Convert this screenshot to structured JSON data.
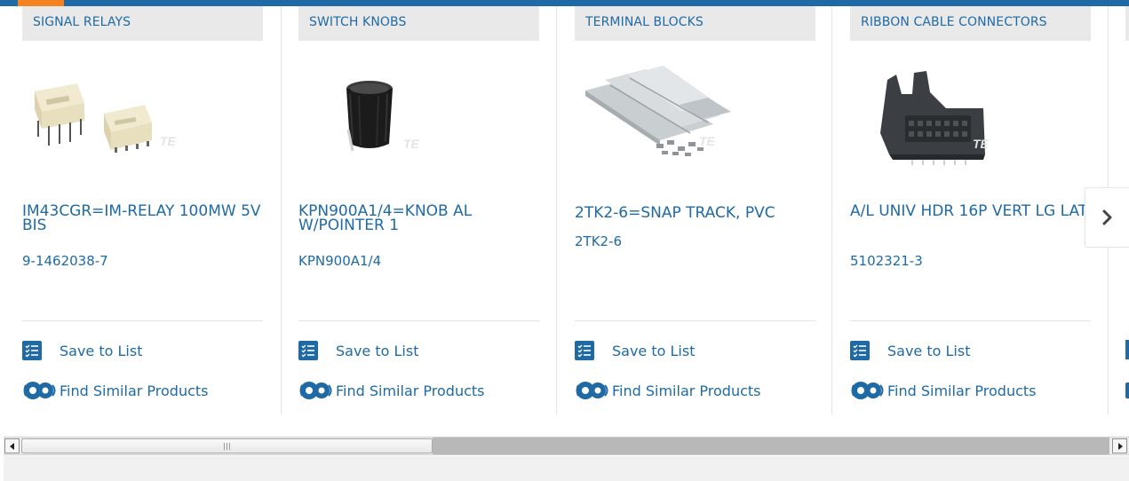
{
  "colors": {
    "brand_blue": "#1f6aa5",
    "accent_orange": "#f58220",
    "tab_bg": "#e9e9e9"
  },
  "carousel": {
    "cards": [
      {
        "category": "SIGNAL RELAYS",
        "title": "IM43CGR=IM-RELAY 100MW 5V BIS",
        "part_number": "9-1462038-7",
        "image": "signal-relays-product-image",
        "save_label": "Save to List",
        "similar_label": "Find Similar Products"
      },
      {
        "category": "SWITCH KNOBS",
        "title": "KPN900A1/4=KNOB AL W/POINTER 1",
        "part_number": "KPN900A1/4",
        "image": "switch-knob-product-image",
        "save_label": "Save to List",
        "similar_label": "Find Similar Products"
      },
      {
        "category": "TERMINAL BLOCKS",
        "title": "2TK2-6=SNAP TRACK, PVC",
        "part_number": "2TK2-6",
        "image": "terminal-blocks-product-image",
        "save_label": "Save to List",
        "similar_label": "Find Similar Products"
      },
      {
        "category": "RIBBON CABLE CONNECTORS",
        "title": "A/L UNIV HDR 16P VERT LG LAT",
        "part_number": "5102321-3",
        "image": "ribbon-cable-connector-product-image",
        "save_label": "Save to List",
        "similar_label": "Find Similar Products"
      }
    ],
    "next_icon": "chevron-right-icon",
    "watermark": "TE"
  },
  "scrollbar": {
    "left_icon": "scroll-left-arrow-icon",
    "right_icon": "scroll-right-arrow-icon"
  }
}
